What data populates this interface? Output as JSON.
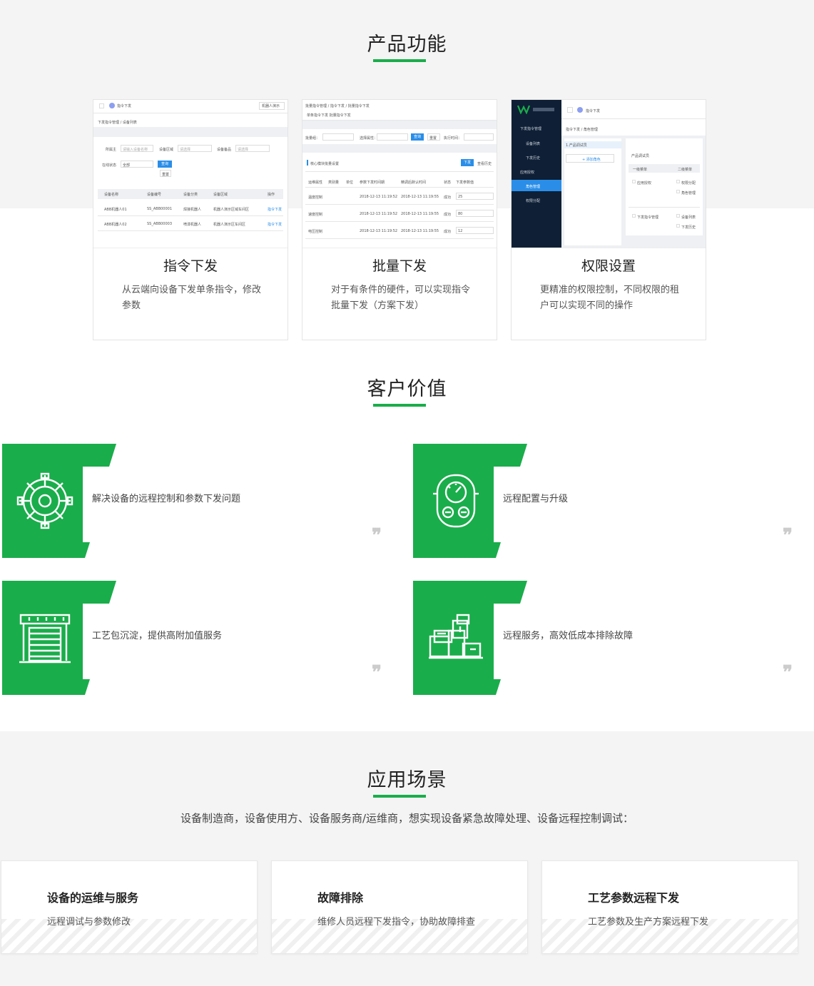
{
  "features": {
    "title": "产品功能",
    "cards": [
      {
        "name": "指令下发",
        "desc": "从云端向设备下发单条指令，修改参数",
        "shot": {
          "topbar_title": "指令下发",
          "topbar_right": "机器人演示",
          "breadcrumb": "下发指令管理  /  设备列表",
          "filters": [
            "所属主",
            "请输入设备名称",
            "设备区域",
            "请选择",
            "设备备品",
            "请选择"
          ],
          "status_label": "在线状态",
          "status_value": "全部",
          "query_btn": "查询",
          "reset_btn": "重置",
          "columns": [
            "设备名称",
            "设备编号",
            "设备分类",
            "设备区域",
            "操作"
          ],
          "rows": [
            [
              "ABB机器人01",
              "SS_ABB00001",
              "焊接机器人",
              "机器人演示区域车间区",
              "指令下发"
            ],
            [
              "ABB机器人02",
              "SS_ABB00003",
              "喷漆机器人",
              "机器人演示区车间区",
              "指令下发"
            ]
          ]
        }
      },
      {
        "name": "批量下发",
        "desc": "对于有条件的硬件，可以实现指令批量下发（方案下发）",
        "shot": {
          "breadcrumb": "批量指令管理  /  指令下发  /  批量指令下发",
          "tabs": "单条指令下发  批量指令下发",
          "filter_labels": [
            "批量组：",
            "选择属性：",
            "执行时间："
          ],
          "query_btn": "查询",
          "reset_btn": "重置",
          "section_label": "核心模块批量设置",
          "send_btn": "下发",
          "history_btn": "查看历史",
          "columns": [
            "运维属性",
            "类别量",
            "单位",
            "参数下发时间期",
            "精调后默认时间",
            "状态",
            "下发参数值"
          ],
          "rows": [
            [
              "温度控制",
              "",
              "",
              "2018-12-13 11:19:52",
              "2018-12-13 11:19:55",
              "成功",
              "25"
            ],
            [
              "速度控制",
              "",
              "",
              "2018-12-13 11:19:52",
              "2018-12-13 11:19:55",
              "成功",
              "80"
            ],
            [
              "电压控制",
              "",
              "",
              "2018-12-13 11:19:52",
              "2018-12-13 11:19:55",
              "成功",
              "12"
            ]
          ]
        }
      },
      {
        "name": "权限设置",
        "desc": "更精准的权限控制，不同权限的租户可以实现不同的操作",
        "shot": {
          "topbar_title": "指令下发",
          "breadcrumb": "指令下发  /  角色管理",
          "menu": [
            "下发指令管理",
            "设备列表",
            "下发历史",
            "应用授权",
            "角色管理",
            "权限分配"
          ],
          "role_item": "1.产品调试员",
          "add_btn": "+  添加角色",
          "perm_title": "产品调试员",
          "perm_columns": [
            "一级菜单",
            "二级菜单"
          ],
          "perm_rows": [
            [
              "应用授权",
              "权限分配"
            ],
            [
              "",
              "角色管理"
            ],
            [
              "下发指令管理",
              "设备列表"
            ],
            [
              "",
              "下发历史"
            ]
          ]
        }
      }
    ]
  },
  "values": {
    "title": "客户价值",
    "items": [
      {
        "icon": "gear-icon",
        "text": "解决设备的远程控制和参数下发问题"
      },
      {
        "icon": "gauge-panel-icon",
        "text": "远程配置与升级"
      },
      {
        "icon": "warehouse-icon",
        "text": "工艺包沉淀，提供高附加值服务"
      },
      {
        "icon": "boxes-icon",
        "text": "远程服务，高效低成本排除故障"
      }
    ],
    "quote_mark": "❞"
  },
  "scenes": {
    "title": "应用场景",
    "subtitle": "设备制造商，设备使用方、设备服务商/运维商，想实现设备紧急故障处理、设备远程控制调试：",
    "cards": [
      {
        "title": "设备的运维与服务",
        "desc": "远程调试与参数修改"
      },
      {
        "title": "故障排除",
        "desc": "维修人员远程下发指令，协助故障排查"
      },
      {
        "title": "工艺参数远程下发",
        "desc": "工艺参数及生产方案远程下发"
      }
    ]
  },
  "colors": {
    "accent": "#1aad4b",
    "dark_nav": "#0f1f35",
    "link_blue": "#2a8ee8"
  }
}
